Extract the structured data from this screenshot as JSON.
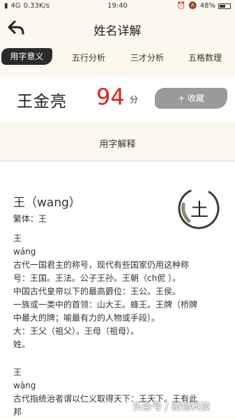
{
  "status_bar": {
    "carrier": "4G",
    "speed": "0.33K/s",
    "time": "19:40",
    "battery": "48%"
  },
  "header": {
    "title": "姓名详解",
    "back_icon": "back-arrow-icon"
  },
  "tabs": [
    {
      "label": "用字意义",
      "active": true
    },
    {
      "label": "五行分析"
    },
    {
      "label": "三才分析"
    },
    {
      "label": "五格数理"
    }
  ],
  "result": {
    "name": "王金亮",
    "score": "94",
    "score_unit": "分",
    "favorite_label": "+ 收藏"
  },
  "section": {
    "title": "用字解释"
  },
  "character": {
    "heading": "王（wang）",
    "traditional": "繁体：王",
    "element": "土",
    "lines": [
      "王",
      "wáng",
      "古代一国君主的称号，现代有些国家仍用这种称",
      "号：王国。王法。公子王孙。王朝（ch伲 ）。",
      "中国古代皇帝以下的最高爵位：王公。王侯。",
      "一族或一类中的首领：山大王。蜂王。王牌（桥牌",
      "中最大的牌；喻最有力的人物或手段）。",
      "大：王父（祖父）。王母（祖母）。",
      "姓。",
      "",
      "王",
      "wàng",
      "古代指统治者谓以仁义取得天下：王天下。王有此",
      "邦"
    ]
  },
  "watermark": "头条号 / 微物科技",
  "colors": {
    "background": "#fbf8ee",
    "score": "#e0201f",
    "tab_active": "#2a2a2a",
    "favorite": "#9a9a9a"
  }
}
